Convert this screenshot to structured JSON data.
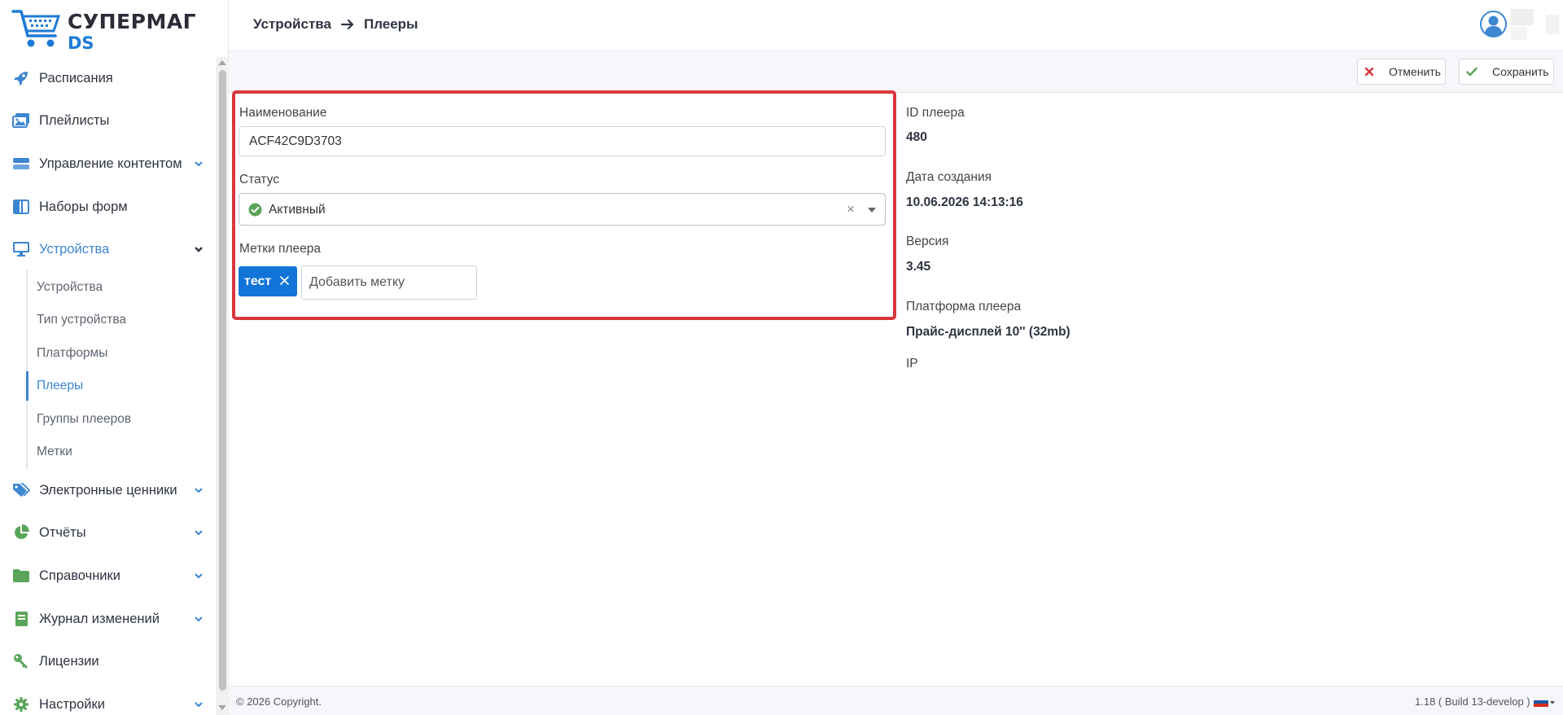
{
  "app": {
    "logo_text1": "СУПЕРМАГ",
    "logo_text2": "DS",
    "accent_color": "#3d86d1",
    "tag_color": "#1274d8",
    "highlight_color": "#d9363e"
  },
  "sidebar": {
    "items": [
      {
        "label": "Расписания",
        "icon": "rocket-icon"
      },
      {
        "label": "Плейлисты",
        "icon": "images-icon"
      },
      {
        "label": "Управление контентом",
        "icon": "content-icon"
      },
      {
        "label": "Наборы форм",
        "icon": "layout-columns-icon"
      },
      {
        "label": "Устройства",
        "icon": "monitor-icon"
      },
      {
        "label": "Электронные ценники",
        "icon": "tags-icon"
      },
      {
        "label": "Отчёты",
        "icon": "pie-chart-icon"
      },
      {
        "label": "Справочники",
        "icon": "folder-icon"
      },
      {
        "label": "Журнал изменений",
        "icon": "book-icon"
      },
      {
        "label": "Лицензии",
        "icon": "key-icon"
      },
      {
        "label": "Настройки",
        "icon": "gear-icon"
      }
    ],
    "sub_items": [
      {
        "label": "Устройства"
      },
      {
        "label": "Тип устройства"
      },
      {
        "label": "Платформы"
      },
      {
        "label": "Плееры"
      },
      {
        "label": "Группы плееров"
      },
      {
        "label": "Метки"
      }
    ]
  },
  "header": {
    "breadcrumb_parent": "Устройства",
    "breadcrumb_current": "Плееры"
  },
  "toolbar": {
    "cancel_label": "Отменить",
    "save_label": "Сохранить"
  },
  "form": {
    "name_label": "Наименование",
    "name_value": "ACF42C9D3703",
    "status_label": "Статус",
    "status_value": "Активный",
    "tags_label": "Метки плеера",
    "tags": [
      "тест"
    ],
    "tag_input_placeholder": "Добавить метку"
  },
  "info": {
    "player_id_label": "ID плеера",
    "player_id_value": "480",
    "created_label": "Дата создания",
    "created_value": "10.06.2026 14:13:16",
    "version_label": "Версия",
    "version_value": "3.45",
    "platform_label": "Платформа плеера",
    "platform_value": "Прайс-дисплей 10'' (32mb)",
    "ip_label": "IP"
  },
  "footer": {
    "copyright": "© 2026 Copyright.",
    "version": "1.18 ( Build 13-develop )"
  }
}
